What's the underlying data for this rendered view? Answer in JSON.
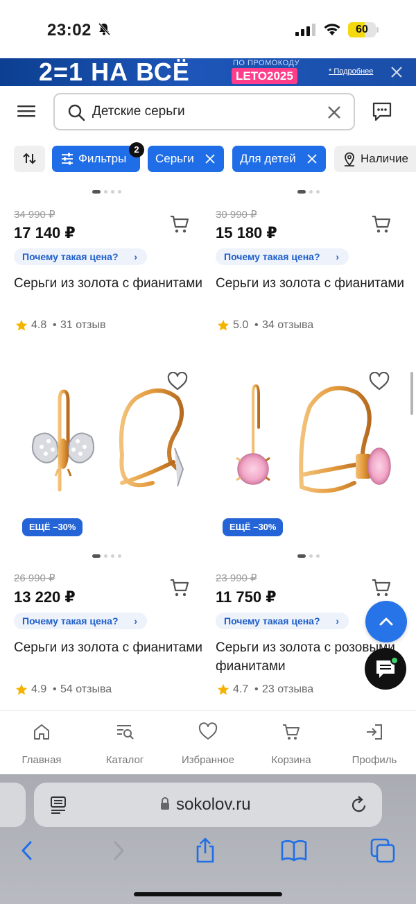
{
  "status_bar": {
    "time": "23:02",
    "battery": "60",
    "battery_level": 0.6
  },
  "promo": {
    "title": "2=1 НА ВСЁ",
    "subtitle": "ПО ПРОМОКОДУ",
    "code": "LETO2025",
    "more_link": "* Подробнее"
  },
  "search": {
    "value": "Детские серьги"
  },
  "filters": {
    "filters_label": "Фильтры",
    "filters_count": "2",
    "chips": [
      "Серьги",
      "Для детей"
    ],
    "availability_label": "Наличие"
  },
  "products": [
    {
      "old_price": "34 990 ₽",
      "price": "17 140 ₽",
      "why_price": "Почему такая цена?",
      "name": "Серьги из золота с фианитами",
      "rating": "4.8",
      "reviews": "31 отзыв"
    },
    {
      "old_price": "30 990 ₽",
      "price": "15 180 ₽",
      "why_price": "Почему такая цена?",
      "name": "Серьги из золота с фианитами",
      "rating": "5.0",
      "reviews": "34 отзыва"
    },
    {
      "discount": "ЕЩЁ –30%",
      "old_price": "26 990 ₽",
      "price": "13 220 ₽",
      "why_price": "Почему такая цена?",
      "name": "Серьги из золота с фианитами",
      "rating": "4.9",
      "reviews": "54 отзыва"
    },
    {
      "discount": "ЕЩЁ –30%",
      "old_price": "23 990 ₽",
      "price": "11 750 ₽",
      "why_price": "Почему такая цена?",
      "name": "Серьги из золота с розовыми фианитами",
      "rating": "4.7",
      "reviews": "23 отзыва"
    }
  ],
  "bottom_nav": [
    {
      "label": "Главная",
      "icon": "home-icon"
    },
    {
      "label": "Каталог",
      "icon": "catalog-search-icon"
    },
    {
      "label": "Избранное",
      "icon": "heart-icon"
    },
    {
      "label": "Корзина",
      "icon": "cart-icon"
    },
    {
      "label": "Профиль",
      "icon": "login-icon"
    }
  ],
  "browser": {
    "url": "sokolov.ru"
  },
  "colors": {
    "accent": "#1f6ee8",
    "promo_bg": "#1a4ea8",
    "promo_code": "#ff3d8a",
    "star": "#f5b301",
    "pink_stone": "#f2a9c8",
    "gold": "#e39a3c"
  }
}
